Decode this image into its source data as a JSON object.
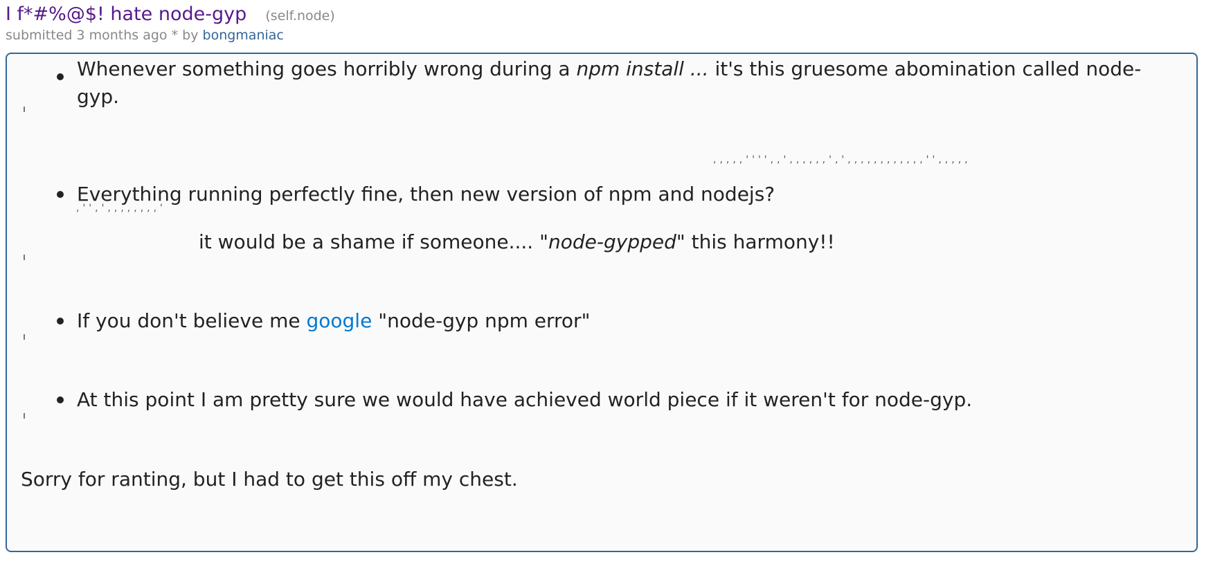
{
  "post": {
    "title": "I f*#%@$! hate node-gyp",
    "domain": "(self.node)",
    "tagline_prefix": "submitted",
    "time": "3 months ago",
    "separator": "* by",
    "author": "bongmaniac"
  },
  "body": {
    "bullet1": {
      "pre": "Whenever something goes horribly wrong during a ",
      "em": "npm install ...",
      "post": " it's this gruesome abomination called node-gyp."
    },
    "tick_row_1": ",,,,,'''',,',,,,,,',',,,,,,,,,,,,'',,,,,",
    "bullet2": {
      "text": "Everything running perfectly fine, then new version of npm and nodejs?"
    },
    "tick_row_2": ",'',',,,,,,,,'",
    "indented": {
      "pre": "it would be a shame if someone.... ",
      "em": "\"node-gypped\"",
      "post": " this harmony!!"
    },
    "bullet3": {
      "pre": "If you don't believe me ",
      "link": "google",
      "post": " \"node-gyp npm error\""
    },
    "bullet4": {
      "text": "At this point I am pretty sure we would have achieved world piece if it weren't for node-gyp."
    },
    "closing": "Sorry for ranting, but I had to get this off my chest."
  }
}
